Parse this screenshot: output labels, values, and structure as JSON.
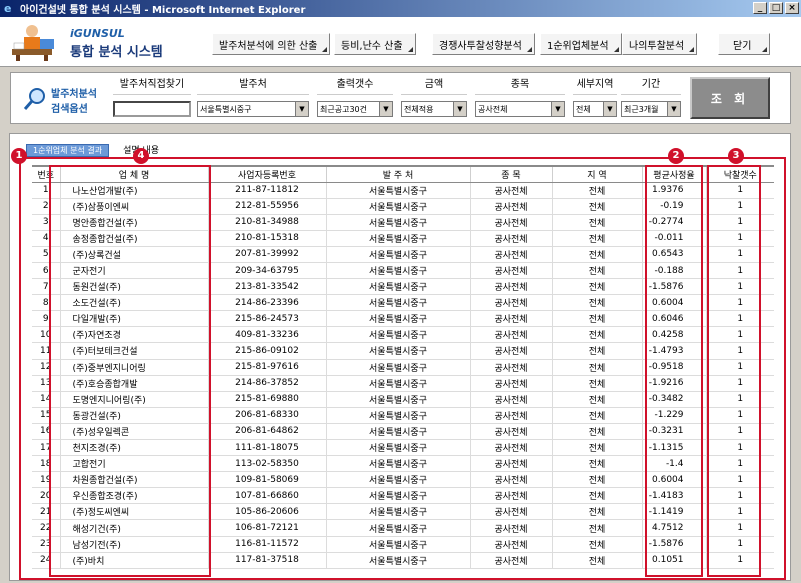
{
  "window": {
    "title": "아이건설넷 통합 분석 시스템 - Microsoft Internet Explorer",
    "buttons": [
      "_",
      "□",
      "×"
    ]
  },
  "header": {
    "brand": "iGUNSUL",
    "title": "통합 분석 시스템",
    "nav": [
      {
        "label": "발주처분석에 의한 산출"
      },
      {
        "label": "등비,난수 산출"
      },
      {
        "label": "경쟁사투찰성향분석"
      },
      {
        "label": "1순위업체분석"
      },
      {
        "label": "나의투찰분석"
      }
    ],
    "close_label": "닫기"
  },
  "search": {
    "label_line1": "발주처분석",
    "label_line2": "검색옵션",
    "columns": [
      {
        "label": "발주처직접찾기",
        "value": ""
      },
      {
        "label": "발주처",
        "value": "서울특별시중구"
      },
      {
        "label": "출력갯수",
        "value": "최근공고30건"
      },
      {
        "label": "금액",
        "value": "전체적용"
      },
      {
        "label": "종목",
        "value": "공사전체"
      },
      {
        "label": "세부지역",
        "value": "전체"
      },
      {
        "label": "기간",
        "value": "최근3개월"
      }
    ],
    "query_label": "조 회"
  },
  "tabs": {
    "active": "1순위업체 분석 결과",
    "other": "설명 내용"
  },
  "annotations": [
    "1",
    "2",
    "3",
    "4"
  ],
  "table": {
    "headers": [
      "번호",
      "업 체 명",
      "사업자등록번호",
      "발 주 처",
      "종 목",
      "지 역",
      "평균사정율",
      "낙찰갯수"
    ],
    "rows": [
      [
        "1",
        "나노산업개발(주)",
        "211-87-11812",
        "서울특별시중구",
        "공사전체",
        "전체",
        "1.9376",
        "1"
      ],
      [
        "2",
        "(주)삼풍이엔씨",
        "212-81-55956",
        "서울특별시중구",
        "공사전체",
        "전체",
        "-0.19",
        "1"
      ],
      [
        "3",
        "명안종합건설(주)",
        "210-81-34988",
        "서울특별시중구",
        "공사전체",
        "전체",
        "-0.2774",
        "1"
      ],
      [
        "4",
        "송정종합건설(주)",
        "210-81-15318",
        "서울특별시중구",
        "공사전체",
        "전체",
        "-0.011",
        "1"
      ],
      [
        "5",
        "(주)상록건설",
        "207-81-39992",
        "서울특별시중구",
        "공사전체",
        "전체",
        "0.6543",
        "1"
      ],
      [
        "6",
        "군자전기",
        "209-34-63795",
        "서울특별시중구",
        "공사전체",
        "전체",
        "-0.188",
        "1"
      ],
      [
        "7",
        "동원건설(주)",
        "213-81-33542",
        "서울특별시중구",
        "공사전체",
        "전체",
        "-1.5876",
        "1"
      ],
      [
        "8",
        "소도건설(주)",
        "214-86-23396",
        "서울특별시중구",
        "공사전체",
        "전체",
        "0.6004",
        "1"
      ],
      [
        "9",
        "다일개발(주)",
        "215-86-24573",
        "서울특별시중구",
        "공사전체",
        "전체",
        "0.6046",
        "1"
      ],
      [
        "10",
        "(주)자연조경",
        "409-81-33236",
        "서울특별시중구",
        "공사전체",
        "전체",
        "0.4258",
        "1"
      ],
      [
        "11",
        "(주)터보테크건설",
        "215-86-09102",
        "서울특별시중구",
        "공사전체",
        "전체",
        "-1.4793",
        "1"
      ],
      [
        "12",
        "(주)중부엔지니어링",
        "215-81-97616",
        "서울특별시중구",
        "공사전체",
        "전체",
        "-0.9518",
        "1"
      ],
      [
        "13",
        "(주)호승종합개발",
        "214-86-37852",
        "서울특별시중구",
        "공사전체",
        "전체",
        "-1.9216",
        "1"
      ],
      [
        "14",
        "도명엔지니어링(주)",
        "215-81-69880",
        "서울특별시중구",
        "공사전체",
        "전체",
        "-0.3482",
        "1"
      ],
      [
        "15",
        "동광건설(주)",
        "206-81-68330",
        "서울특별시중구",
        "공사전체",
        "전체",
        "-1.229",
        "1"
      ],
      [
        "16",
        "(주)성우일렉콘",
        "206-81-64862",
        "서울특별시중구",
        "공사전체",
        "전체",
        "-0.3231",
        "1"
      ],
      [
        "17",
        "천지조경(주)",
        "111-81-18075",
        "서울특별시중구",
        "공사전체",
        "전체",
        "-1.1315",
        "1"
      ],
      [
        "18",
        "고합전기",
        "113-02-58350",
        "서울특별시중구",
        "공사전체",
        "전체",
        "-1.4",
        "1"
      ],
      [
        "19",
        "차원종합건설(주)",
        "109-81-58069",
        "서울특별시중구",
        "공사전체",
        "전체",
        "0.6004",
        "1"
      ],
      [
        "20",
        "우신종합조경(주)",
        "107-81-66860",
        "서울특별시중구",
        "공사전체",
        "전체",
        "-1.4183",
        "1"
      ],
      [
        "21",
        "(주)정도씨엔씨",
        "105-86-20606",
        "서울특별시중구",
        "공사전체",
        "전체",
        "-1.1419",
        "1"
      ],
      [
        "22",
        "해성기건(주)",
        "106-81-72121",
        "서울특별시중구",
        "공사전체",
        "전체",
        "4.7512",
        "1"
      ],
      [
        "23",
        "남성기전(주)",
        "116-81-11572",
        "서울특별시중구",
        "공사전체",
        "전체",
        "-1.5876",
        "1"
      ],
      [
        "24",
        "(주)바치",
        "117-81-37518",
        "서울특별시중구",
        "공사전체",
        "전체",
        "0.1051",
        "1"
      ]
    ]
  }
}
